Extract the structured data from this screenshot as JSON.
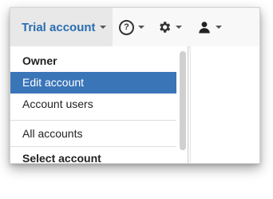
{
  "navbar": {
    "account_label": "Trial account",
    "help_icon": "?",
    "settings_icon": "gear-icon",
    "user_icon": "user-icon"
  },
  "menu": {
    "items": [
      {
        "label": "Owner",
        "type": "header"
      },
      {
        "label": "Edit account",
        "type": "item",
        "active": true
      },
      {
        "label": "Account users",
        "type": "item"
      },
      {
        "label": "All accounts",
        "type": "item"
      },
      {
        "label": "Select account",
        "type": "header"
      }
    ]
  },
  "colors": {
    "accent": "#2a6db0",
    "active_bg": "#3a75b8"
  }
}
